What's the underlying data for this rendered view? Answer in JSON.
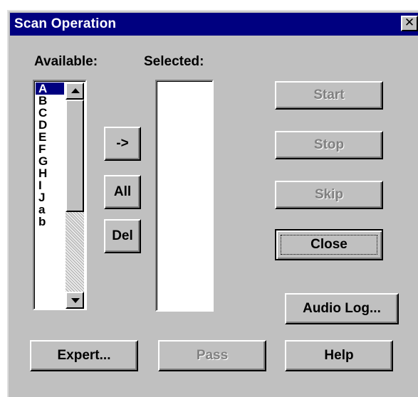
{
  "window": {
    "title": "Scan Operation",
    "close_glyph": "✕"
  },
  "labels": {
    "available": "Available:",
    "selected": "Selected:"
  },
  "available_list": {
    "items": [
      "A",
      "B",
      "C",
      "D",
      "E",
      "F",
      "G",
      "H",
      "I",
      "J",
      "a",
      "b"
    ],
    "selected_item": "A"
  },
  "selected_list": {
    "items": []
  },
  "buttons": {
    "add": "->",
    "all": "All",
    "del": "Del",
    "start": "Start",
    "stop": "Stop",
    "skip": "Skip",
    "close": "Close",
    "audio_log": "Audio Log...",
    "expert": "Expert...",
    "pass": "Pass",
    "help": "Help"
  },
  "button_states": {
    "start": "disabled",
    "stop": "disabled",
    "skip": "disabled",
    "pass": "disabled",
    "close": "default-focused"
  },
  "icons": {
    "scroll_up": "scroll-up-arrow-icon",
    "scroll_down": "scroll-down-arrow-icon",
    "close": "close-icon"
  },
  "colors": {
    "titlebar": "#000080",
    "face": "#c0c0c0",
    "selection": "#000080",
    "disabled_text": "#808080"
  }
}
